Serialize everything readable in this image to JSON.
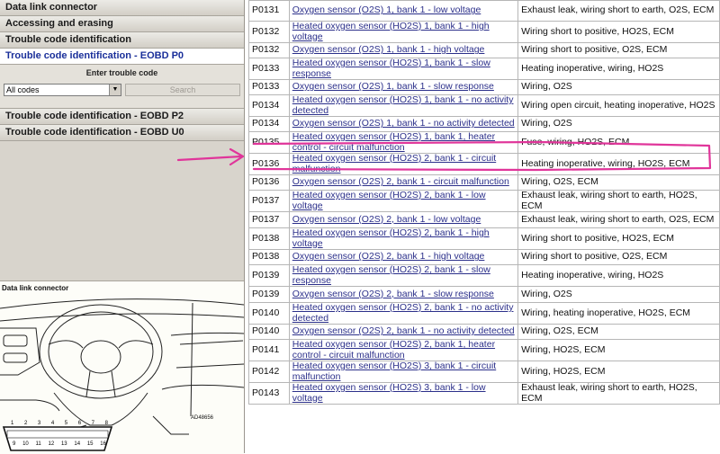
{
  "nav": {
    "items": [
      {
        "label": "Data link connector"
      },
      {
        "label": "Accessing and erasing"
      },
      {
        "label": "Trouble code identification"
      },
      {
        "label": "Trouble code identification - EOBD P0"
      }
    ],
    "trouble": {
      "enter_label": "Enter trouble code",
      "select_value": "All codes",
      "search_label": "Search"
    },
    "items_after": [
      {
        "label": "Trouble code identification - EOBD P2"
      },
      {
        "label": "Trouble code identification - EOBD U0"
      }
    ]
  },
  "diagram": {
    "title": "Data link connector",
    "ref": "AD48656",
    "pins_top": [
      "1",
      "2",
      "3",
      "4",
      "5",
      "6",
      "7",
      "8"
    ],
    "pins_bottom": [
      "9",
      "10",
      "11",
      "12",
      "13",
      "14",
      "15",
      "16"
    ]
  },
  "annotation": {
    "color": "#e0359a",
    "highlighted_code": "P0135"
  },
  "table": {
    "rows": [
      {
        "code": "P0131",
        "desc": "Oxygen sensor (O2S) 1, bank 1 - low voltage",
        "cause": "Exhaust leak, wiring short to earth, O2S, ECM"
      },
      {
        "code": "P0132",
        "desc": "Heated oxygen sensor (HO2S) 1, bank 1 - high voltage",
        "cause": "Wiring short to positive, HO2S, ECM"
      },
      {
        "code": "P0132",
        "desc": "Oxygen sensor (O2S) 1, bank 1 - high voltage",
        "cause": "Wiring short to positive, O2S, ECM"
      },
      {
        "code": "P0133",
        "desc": "Heated oxygen sensor (HO2S) 1, bank 1 - slow response",
        "cause": "Heating inoperative, wiring, HO2S"
      },
      {
        "code": "P0133",
        "desc": "Oxygen sensor (O2S) 1, bank 1 - slow response",
        "cause": "Wiring, O2S"
      },
      {
        "code": "P0134",
        "desc": "Heated oxygen sensor (HO2S) 1, bank 1 - no activity detected",
        "cause": "Wiring open circuit, heating inoperative, HO2S"
      },
      {
        "code": "P0134",
        "desc": "Oxygen sensor (O2S) 1, bank 1 - no activity detected",
        "cause": "Wiring, O2S"
      },
      {
        "code": "P0135",
        "desc": "Heated oxygen sensor (HO2S) 1, bank 1, heater control - circuit malfunction",
        "cause": "Fuse, wiring, HO2S, ECM"
      },
      {
        "code": "P0136",
        "desc": "Heated oxygen sensor (HO2S) 2, bank 1 - circuit malfunction",
        "cause": "Heating inoperative, wiring, HO2S, ECM"
      },
      {
        "code": "P0136",
        "desc": "Oxygen sensor (O2S) 2, bank 1 - circuit malfunction",
        "cause": "Wiring, O2S, ECM"
      },
      {
        "code": "P0137",
        "desc": "Heated oxygen sensor (HO2S) 2, bank 1 - low voltage",
        "cause": "Exhaust leak, wiring short to earth, HO2S, ECM"
      },
      {
        "code": "P0137",
        "desc": "Oxygen sensor (O2S) 2, bank 1 - low voltage",
        "cause": "Exhaust leak, wiring short to earth, O2S, ECM"
      },
      {
        "code": "P0138",
        "desc": "Heated oxygen sensor (HO2S) 2, bank 1 - high voltage",
        "cause": "Wiring short to positive, HO2S, ECM"
      },
      {
        "code": "P0138",
        "desc": "Oxygen sensor (O2S) 2, bank 1 - high voltage",
        "cause": "Wiring short to positive, O2S, ECM"
      },
      {
        "code": "P0139",
        "desc": "Heated oxygen sensor (HO2S) 2, bank 1 - slow response",
        "cause": "Heating inoperative, wiring, HO2S"
      },
      {
        "code": "P0139",
        "desc": "Oxygen sensor (O2S) 2, bank 1 - slow response",
        "cause": "Wiring, O2S"
      },
      {
        "code": "P0140",
        "desc": "Heated oxygen sensor (HO2S) 2, bank 1 - no activity detected",
        "cause": "Wiring, heating inoperative, HO2S, ECM"
      },
      {
        "code": "P0140",
        "desc": "Oxygen sensor (O2S) 2, bank 1 - no activity detected",
        "cause": "Wiring, O2S, ECM"
      },
      {
        "code": "P0141",
        "desc": "Heated oxygen sensor (HO2S) 2, bank 1, heater control - circuit malfunction",
        "cause": "Wiring, HO2S, ECM"
      },
      {
        "code": "P0142",
        "desc": "Heated oxygen sensor (HO2S) 3, bank 1 - circuit malfunction",
        "cause": "Wiring, HO2S, ECM"
      },
      {
        "code": "P0143",
        "desc": "Heated oxygen sensor (HO2S) 3, bank 1 - low voltage",
        "cause": "Exhaust leak, wiring short to earth, HO2S, ECM"
      }
    ]
  }
}
